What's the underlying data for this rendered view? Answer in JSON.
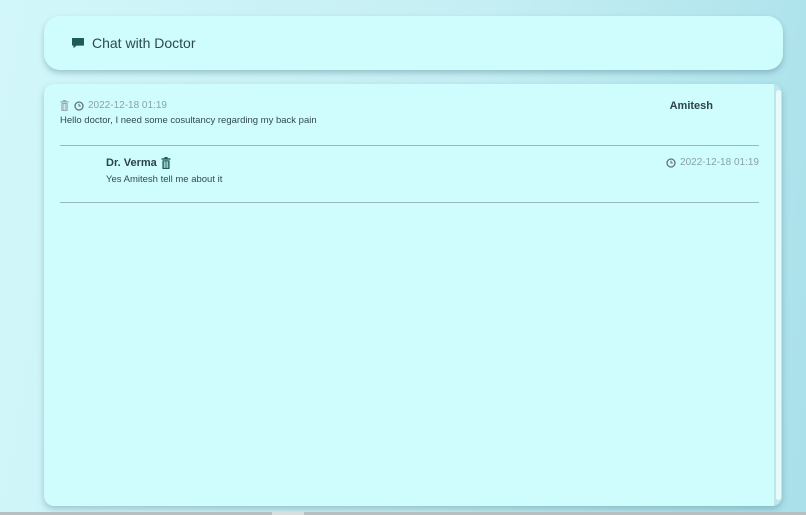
{
  "header": {
    "title": "Chat with Doctor",
    "icon": "chat-bubble-icon"
  },
  "messages": [
    {
      "sender": "Amitesh",
      "timestamp": "2022-12-18 01:19",
      "text": "Hello doctor, I need some cosultancy regarding my back pain"
    },
    {
      "sender": "Dr. Verma",
      "timestamp": "2022-12-18 01:19",
      "text": "Yes Amitesh tell me about it"
    }
  ],
  "colors": {
    "background": "#c4eef3",
    "card": "#cffcfd",
    "accent": "#1e5a58",
    "muted_text": "#8aa2a6"
  }
}
